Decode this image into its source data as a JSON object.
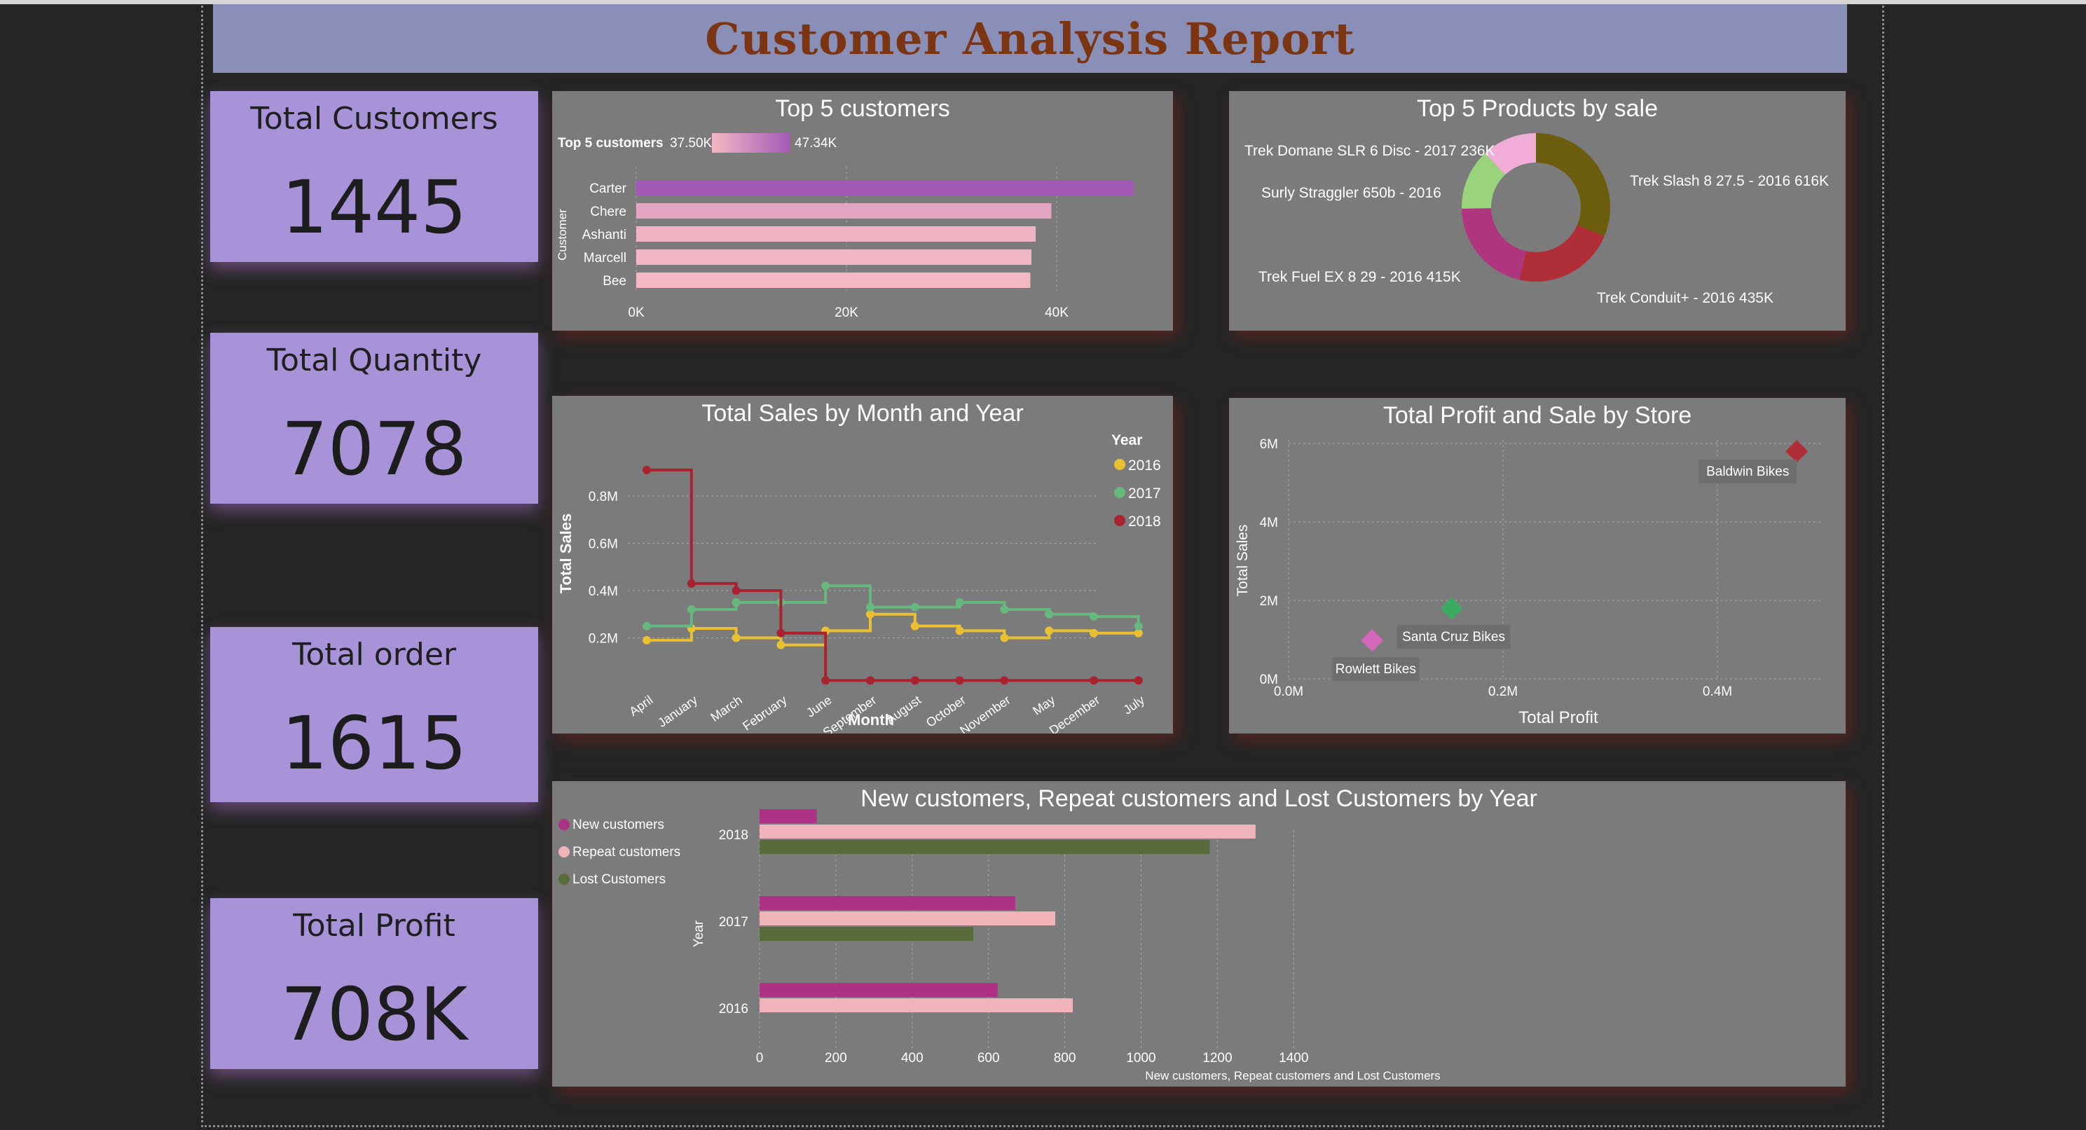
{
  "report_title": "Customer Analysis Report",
  "kpis": [
    {
      "label": "Total Customers",
      "value": "1445"
    },
    {
      "label": "Total Quantity",
      "value": "7078"
    },
    {
      "label": "Total order",
      "value": "1615"
    },
    {
      "label": "Total Profit",
      "value": "708K"
    }
  ],
  "colors": {
    "page_bg": "#252525",
    "banner": "#8a8fb8",
    "title": "#7b3512",
    "kpi_card": "#a893d8",
    "panel": "#7b7b7b"
  },
  "chart_data": [
    {
      "id": "top_customers",
      "type": "bar",
      "orientation": "horizontal",
      "title": "Top 5 customers",
      "legend_title": "Top 5 customers",
      "legend_min_label": "37.50K",
      "legend_max_label": "47.34K",
      "ylabel": "Customer",
      "categories": [
        "Carter",
        "Chere",
        "Ashanti",
        "Marcell",
        "Bee"
      ],
      "values": [
        47340,
        39500,
        38000,
        37600,
        37500
      ],
      "xticks": [
        "0K",
        "20K",
        "40K"
      ],
      "xlim": [
        0,
        50000
      ],
      "grid": true
    },
    {
      "id": "top_products",
      "type": "pie",
      "donut": true,
      "title": "Top 5 Products by sale",
      "slices": [
        {
          "label": "Trek Slash 8 27.5 - 2016 616K",
          "value": 616,
          "color": "#6b5d0d"
        },
        {
          "label": "Trek Conduit+ - 2016 435K",
          "value": 435,
          "color": "#b02e38"
        },
        {
          "label": "Trek Fuel EX 8 29 - 2016 415K",
          "value": 415,
          "color": "#b0357f"
        },
        {
          "label": "Surly Straggler 650b - 2016",
          "value": 260,
          "color": "#9bd27c"
        },
        {
          "label": "Trek Domane SLR 6 Disc - 2017 236K",
          "value": 236,
          "color": "#f1acd8"
        }
      ]
    },
    {
      "id": "sales_by_month",
      "type": "line",
      "step": true,
      "title": "Total Sales by Month and Year",
      "xlabel": "Month",
      "ylabel": "Total Sales",
      "legend_title": "Year",
      "categories": [
        "April",
        "January",
        "March",
        "February",
        "June",
        "September",
        "August",
        "October",
        "November",
        "May",
        "December",
        "July"
      ],
      "yticks": [
        "0.2M",
        "0.4M",
        "0.6M",
        "0.8M"
      ],
      "ylim": [
        0,
        1.0
      ],
      "grid": true,
      "series": [
        {
          "name": "2016",
          "color": "#e8c031",
          "values": [
            0.19,
            0.24,
            0.2,
            0.17,
            0.23,
            0.3,
            0.25,
            0.23,
            0.2,
            0.23,
            0.22,
            0.22
          ]
        },
        {
          "name": "2017",
          "color": "#66b87f",
          "values": [
            0.25,
            0.32,
            0.35,
            0.35,
            0.42,
            0.33,
            0.33,
            0.35,
            0.32,
            0.3,
            0.29,
            0.25
          ]
        },
        {
          "name": "2018",
          "color": "#a8232f",
          "values": [
            0.91,
            0.43,
            0.4,
            0.22,
            0.02,
            0.02,
            0.02,
            0.02,
            0.02,
            null,
            0.02,
            0.02
          ]
        }
      ]
    },
    {
      "id": "profit_sale_store",
      "type": "scatter",
      "title": "Total Profit and Sale by Store",
      "xlabel": "Total Profit",
      "ylabel": "Total Sales",
      "xticks": [
        "0.0M",
        "0.2M",
        "0.4M"
      ],
      "yticks": [
        "0M",
        "2M",
        "4M",
        "6M"
      ],
      "xlim": [
        0,
        0.5
      ],
      "ylim": [
        0,
        6.2
      ],
      "grid": true,
      "points": [
        {
          "label": "Baldwin Bikes",
          "x": 0.474,
          "y": 5.8,
          "color": "#b02e38"
        },
        {
          "label": "Santa Cruz Bikes",
          "x": 0.152,
          "y": 1.8,
          "color": "#3daa62"
        },
        {
          "label": "Rowlett Bikes",
          "x": 0.078,
          "y": 0.98,
          "color": "#d467b8"
        }
      ]
    },
    {
      "id": "customer_types_by_year",
      "type": "bar",
      "orientation": "horizontal",
      "title": "New customers, Repeat customers and Lost Customers by Year",
      "xlabel": "New customers, Repeat customers and Lost Customers",
      "ylabel": "Year",
      "categories": [
        "2018",
        "2017",
        "2016"
      ],
      "xticks": [
        "0",
        "200",
        "400",
        "600",
        "800",
        "1000",
        "1200",
        "1400"
      ],
      "xlim": [
        0,
        1400
      ],
      "grid": true,
      "series": [
        {
          "name": "New customers",
          "color": "#ad3184",
          "values": [
            150,
            670,
            624
          ]
        },
        {
          "name": "Repeat customers",
          "color": "#efb3b9",
          "values": [
            1300,
            775,
            821
          ]
        },
        {
          "name": "Lost Customers",
          "color": "#596b3b",
          "values": [
            1180,
            560,
            null
          ]
        }
      ]
    }
  ]
}
